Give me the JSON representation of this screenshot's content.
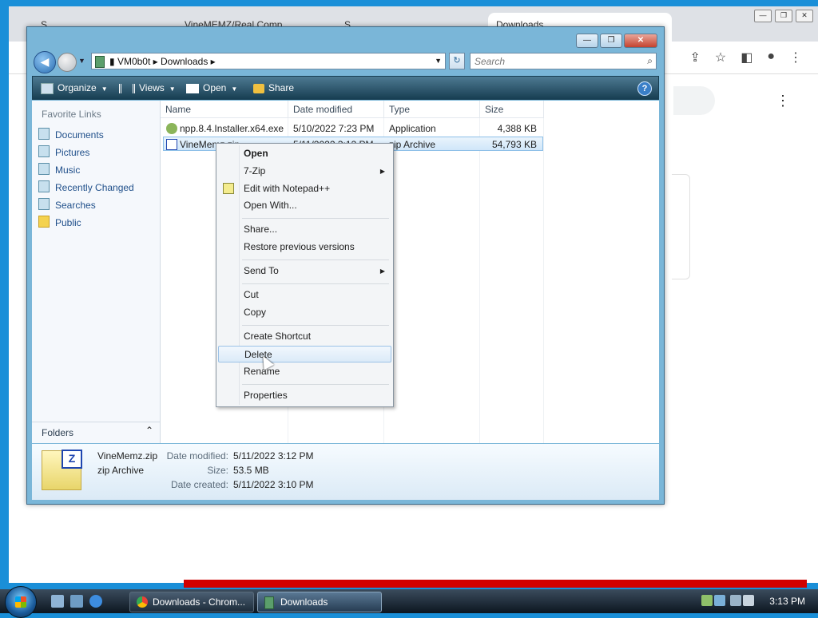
{
  "chrome": {
    "tabs": [
      "S",
      "VineMEMZ/Real Comp",
      "S",
      "Downloads"
    ],
    "window_controls": [
      "—",
      "❐",
      "✕"
    ]
  },
  "explorer": {
    "window_controls": [
      "—",
      "❐",
      "✕"
    ],
    "address": {
      "path": "▮  VM0b0t  ▸  Downloads  ▸"
    },
    "search_placeholder": "Search",
    "toolbar": {
      "organize": "Organize",
      "views": "Views",
      "open": "Open",
      "share": "Share"
    },
    "favorites": {
      "title": "Favorite Links",
      "items": [
        "Documents",
        "Pictures",
        "Music",
        "Recently Changed",
        "Searches",
        "Public"
      ]
    },
    "folders_label": "Folders",
    "columns": [
      "Name",
      "Date modified",
      "Type",
      "Size"
    ],
    "files": [
      {
        "name": "npp.8.4.Installer.x64.exe",
        "date": "5/10/2022 7:23 PM",
        "type": "Application",
        "size": "4,388 KB"
      },
      {
        "name": "VineMemz.zip",
        "date": "5/11/2022 3:12 PM",
        "type": "zip Archive",
        "size": "54,793 KB"
      }
    ],
    "details": {
      "name": "VineMemz.zip",
      "type": "zip Archive",
      "date_modified_label": "Date modified:",
      "date_modified": "5/11/2022 3:12 PM",
      "size_label": "Size:",
      "size": "53.5 MB",
      "date_created_label": "Date created:",
      "date_created": "5/11/2022 3:10 PM"
    }
  },
  "context_menu": {
    "open": "Open",
    "zip7": "7-Zip",
    "notepad": "Edit with Notepad++",
    "open_with": "Open With...",
    "share": "Share...",
    "restore": "Restore previous versions",
    "send_to": "Send To",
    "cut": "Cut",
    "copy": "Copy",
    "create_shortcut": "Create Shortcut",
    "delete": "Delete",
    "rename": "Rename",
    "properties": "Properties"
  },
  "taskbar": {
    "task1": "Downloads - Chrom...",
    "task2": "Downloads",
    "clock": "3:13 PM"
  }
}
